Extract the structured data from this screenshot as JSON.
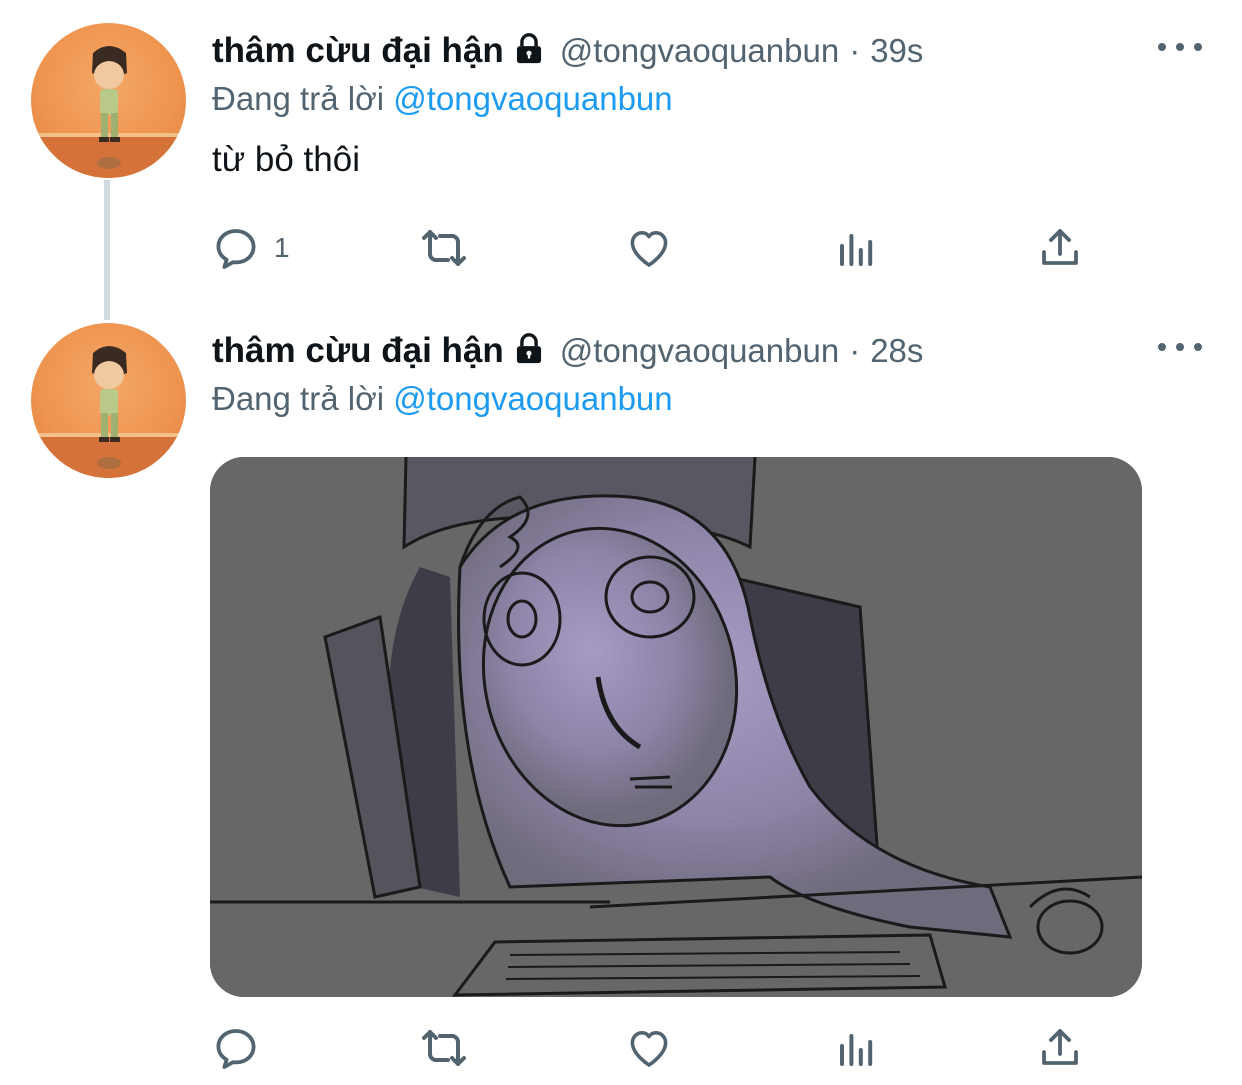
{
  "tweets": [
    {
      "display_name": "thâm cừu đại hận",
      "handle": "@tongvaoquanbun",
      "separator": "·",
      "time": "39s",
      "replying_prefix": "Đang trả lời",
      "replying_mention": "@tongvaoquanbun",
      "text": "từ bỏ thôi",
      "reply_count": "1"
    },
    {
      "display_name": "thâm cừu đại hận",
      "handle": "@tongvaoquanbun",
      "separator": "·",
      "time": "28s",
      "replying_prefix": "Đang trả lời",
      "replying_mention": "@tongvaoquanbun"
    }
  ],
  "icons": {
    "protected": "lock-icon",
    "more": "more-icon",
    "reply": "reply-icon",
    "retweet": "retweet-icon",
    "like": "heart-icon",
    "analytics": "analytics-icon",
    "share": "share-icon"
  },
  "colors": {
    "mention": "#1d9bf0",
    "secondary_text": "#536471",
    "thread_line": "#cfd9de"
  }
}
